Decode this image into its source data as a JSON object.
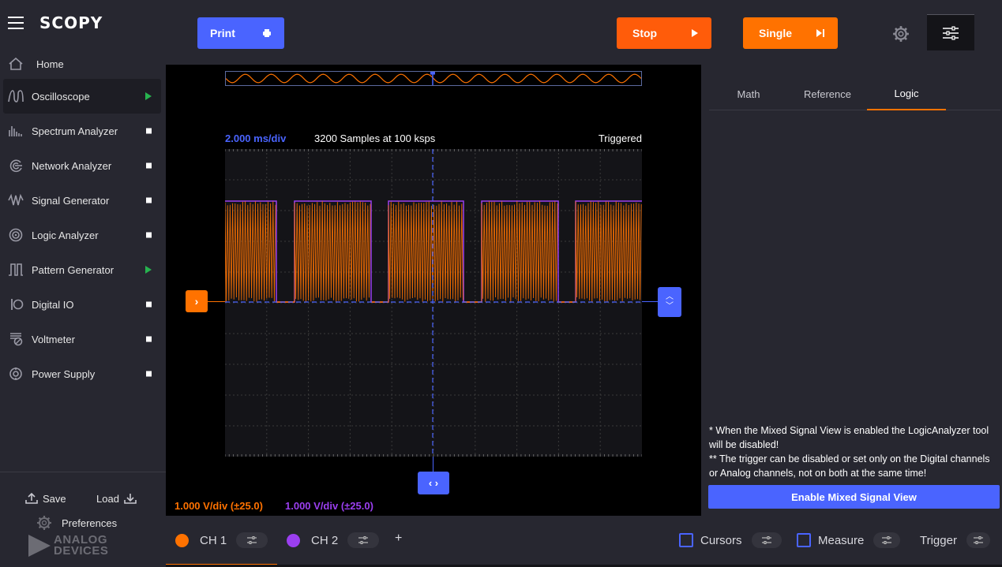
{
  "app": {
    "name": "SCOPY"
  },
  "sidebar": {
    "items": [
      {
        "label": "Home",
        "icon": "home-icon",
        "status": "none"
      },
      {
        "label": "Oscilloscope",
        "icon": "oscilloscope-icon",
        "status": "running"
      },
      {
        "label": "Spectrum Analyzer",
        "icon": "spectrum-icon",
        "status": "stopped"
      },
      {
        "label": "Network Analyzer",
        "icon": "network-icon",
        "status": "stopped"
      },
      {
        "label": "Signal Generator",
        "icon": "signal-icon",
        "status": "stopped"
      },
      {
        "label": "Logic Analyzer",
        "icon": "logic-icon",
        "status": "stopped"
      },
      {
        "label": "Pattern Generator",
        "icon": "pattern-icon",
        "status": "running"
      },
      {
        "label": "Digital IO",
        "icon": "digital-io-icon",
        "status": "stopped"
      },
      {
        "label": "Voltmeter",
        "icon": "voltmeter-icon",
        "status": "stopped"
      },
      {
        "label": "Power Supply",
        "icon": "power-icon",
        "status": "stopped"
      }
    ],
    "save_label": "Save",
    "load_label": "Load",
    "preferences_label": "Preferences",
    "vendor_logo_text": "ANALOG DEVICES"
  },
  "toolbar": {
    "print_label": "Print",
    "stop_label": "Stop",
    "single_label": "Single"
  },
  "plot": {
    "timebase": "2.000 ms/div",
    "samples": "3200 Samples at 100 ksps",
    "trigger_status": "Triggered",
    "ch1_scale": "1.000 V/div (±25.0)",
    "ch2_scale": "1.000 V/div (±25.0)"
  },
  "right_panel": {
    "tabs": [
      {
        "label": "Math"
      },
      {
        "label": "Reference"
      },
      {
        "label": "Logic"
      }
    ],
    "active_tab": "Logic",
    "note_line1": "* When the Mixed Signal View is enabled the LogicAnalyzer tool will be disabled!",
    "note_line2": "** The trigger can be disabled or set only on the Digital channels or Analog channels, not on both at the same time!",
    "mixed_button_label": "Enable Mixed Signal View"
  },
  "bottom": {
    "ch1_label": "CH 1",
    "ch2_label": "CH 2",
    "add_label": "+",
    "cursors_label": "Cursors",
    "measure_label": "Measure",
    "trigger_label": "Trigger"
  },
  "colors": {
    "ch1": "#ff7200",
    "ch2": "#9b3ff0",
    "accent": "#4a64ff",
    "running": "#27b34f"
  }
}
